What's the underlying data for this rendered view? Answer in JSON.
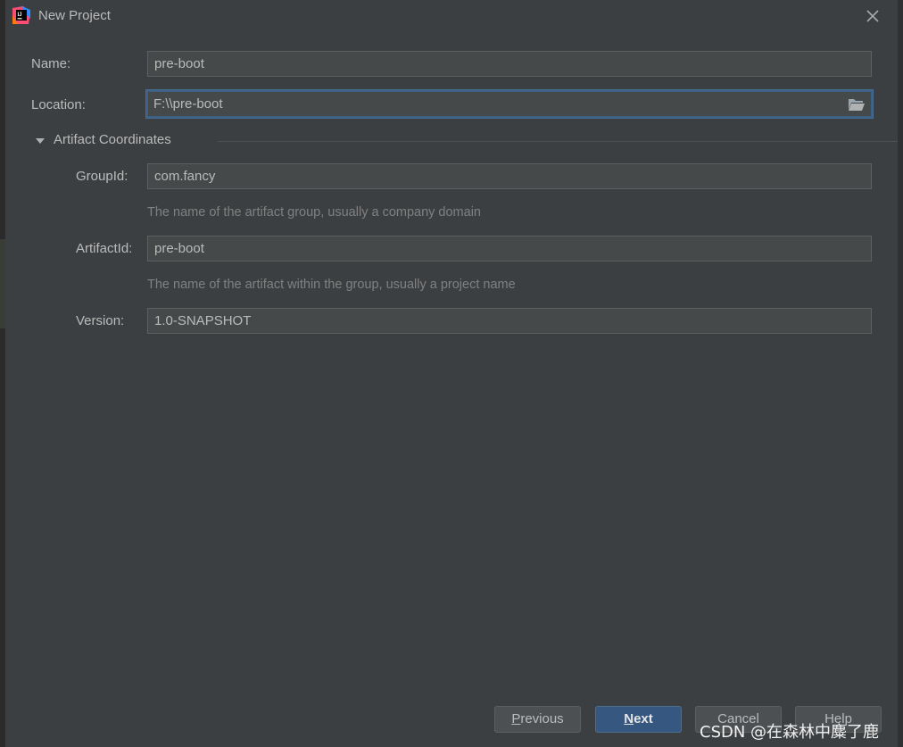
{
  "window": {
    "title": "New Project",
    "app_icon": "intellij-idea-icon",
    "close_icon": "close-icon"
  },
  "form": {
    "name": {
      "label": "Name:",
      "value": "pre-boot"
    },
    "location": {
      "label": "Location:",
      "value": "F:\\\\pre-boot",
      "browse_icon": "folder-icon"
    },
    "artifact_section": {
      "title": "Artifact Coordinates",
      "expanded": true,
      "group_id": {
        "label": "GroupId:",
        "value": "com.fancy",
        "hint": "The name of the artifact group, usually a company domain"
      },
      "artifact_id": {
        "label": "ArtifactId:",
        "value": "pre-boot",
        "hint": "The name of the artifact within the group, usually a project name"
      },
      "version": {
        "label": "Version:",
        "value": "1.0-SNAPSHOT"
      }
    }
  },
  "buttons": {
    "previous": {
      "mnemonic": "P",
      "rest": "revious"
    },
    "next": {
      "mnemonic": "N",
      "rest": "ext"
    },
    "cancel": {
      "label": "Cancel"
    },
    "help": {
      "label": "Help"
    }
  },
  "watermark": "CSDN @在森林中麋了鹿",
  "colors": {
    "background": "#3c3f41",
    "field_background": "#45494a",
    "focus_border": "#3d6185",
    "primary_button": "#365880",
    "text": "#bbbbbb",
    "hint_text": "#808080"
  }
}
